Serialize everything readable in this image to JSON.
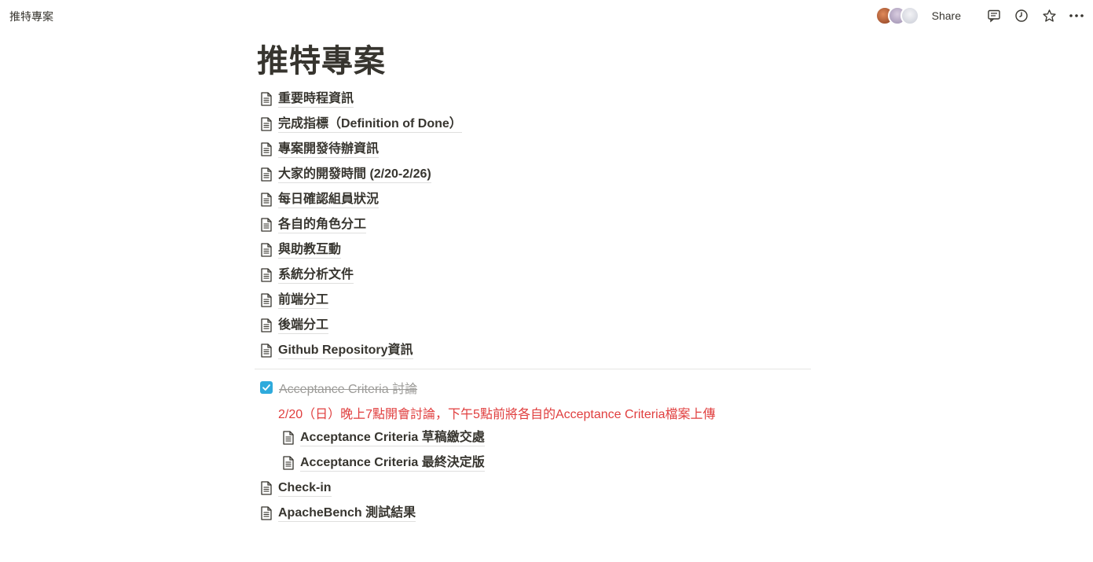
{
  "topbar": {
    "breadcrumb": "推特專案",
    "share_label": "Share",
    "avatars": [
      "avatar-1",
      "avatar-2",
      "avatar-3"
    ],
    "icons": [
      "comment-icon",
      "history-icon",
      "star-icon",
      "more-icon"
    ]
  },
  "page": {
    "title": "推特專案",
    "items": [
      "重要時程資訊",
      "完成指標（Definition of Done）",
      "專案開發待辦資訊",
      "大家的開發時間 (2/20-2/26)",
      "每日確認組員狀況",
      "各自的角色分工",
      "與助教互動",
      "系統分析文件",
      "前端分工",
      "後端分工",
      "Github Repository資訊"
    ],
    "todo": {
      "label": "Acceptance Criteria 討論",
      "checked": true,
      "note": "2/20（日）晚上7點開會討論，下午5點前將各自的Acceptance Criteria檔案上傳",
      "subpages": [
        "Acceptance Criteria 草稿繳交處",
        "Acceptance Criteria 最終決定版"
      ]
    },
    "after_items": [
      "Check-in",
      "ApacheBench 測試結果"
    ]
  },
  "colors": {
    "text": "#37352f",
    "checkbox": "#2eaadc",
    "red_note": "#e03e3e",
    "muted": "#9b9a97"
  }
}
